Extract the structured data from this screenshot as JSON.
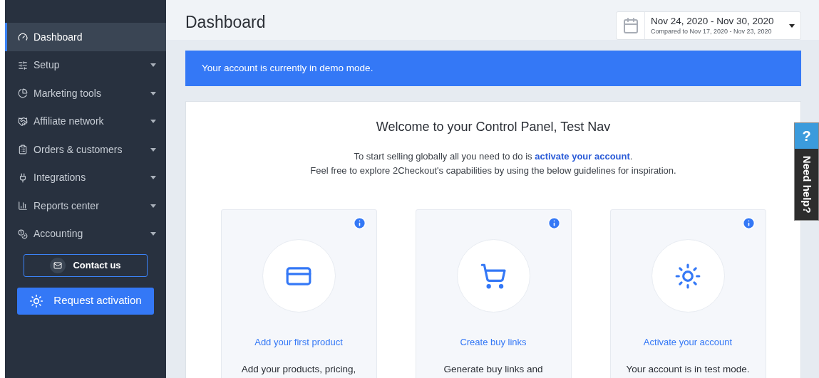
{
  "sidebar": {
    "items": [
      {
        "label": "Dashboard",
        "selected": true,
        "expandable": false
      },
      {
        "label": "Setup",
        "selected": false,
        "expandable": true
      },
      {
        "label": "Marketing tools",
        "selected": false,
        "expandable": true
      },
      {
        "label": "Affiliate network",
        "selected": false,
        "expandable": true
      },
      {
        "label": "Orders & customers",
        "selected": false,
        "expandable": true
      },
      {
        "label": "Integrations",
        "selected": false,
        "expandable": true
      },
      {
        "label": "Reports center",
        "selected": false,
        "expandable": true
      },
      {
        "label": "Accounting",
        "selected": false,
        "expandable": true
      }
    ],
    "contact_button": "Contact us",
    "activation_button": "Request activation"
  },
  "page_title": "Dashboard",
  "date_range": {
    "range": "Nov 24, 2020 - Nov 30, 2020",
    "compared": "Compared to Nov 17, 2020 - Nov 23, 2020"
  },
  "banner": "Your account is currently in demo mode.",
  "welcome": {
    "title": "Welcome to your Control Panel, Test Nav",
    "line_1_before": "To start selling globally all you need to do is ",
    "line_1_link": "activate your account",
    "line_1_after": ".",
    "line_2": "Feel free to explore 2Checkout's capabilities by using the below guidelines for inspiration."
  },
  "tiles": [
    {
      "title": "Add your first product",
      "description": "Add your products, pricing,"
    },
    {
      "title": "Create buy links",
      "description": "Generate buy links and"
    },
    {
      "title": "Activate your account",
      "description": "Your account is in test mode."
    }
  ],
  "help_tab": {
    "mark": "?",
    "label": "Need help?"
  }
}
